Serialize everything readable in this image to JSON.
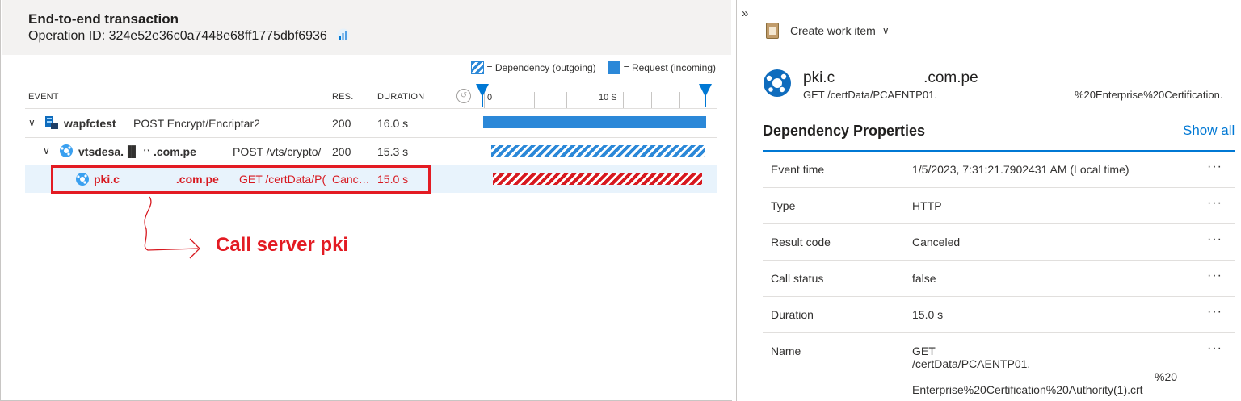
{
  "header": {
    "title": "End-to-end transaction",
    "operation_id": "Operation ID: 324e52e36c0a7448e68ff1775dbf6936"
  },
  "legend": {
    "dependency": "= Dependency (outgoing)",
    "request": "= Request (incoming)"
  },
  "columns": {
    "event": "EVENT",
    "res": "RES.",
    "duration": "DURATION"
  },
  "axis": {
    "start": "0",
    "mid": "10 S"
  },
  "rows": [
    {
      "name": "wapfctest",
      "operation": "POST Encrypt/Encriptar2",
      "res": "200",
      "duration": "16.0 s",
      "start_s": 0.0,
      "dur_s": 16.0
    },
    {
      "name": "vtsdesa.▐▌   ˑˑ .com.pe",
      "operation": "POST /vts/crypto/",
      "res": "200",
      "duration": "15.3 s",
      "start_s": 0.6,
      "dur_s": 15.3
    },
    {
      "name": "pki.c",
      "name_suffix": ".com.pe",
      "operation": "GET /certData/P(",
      "res": "Canc…",
      "duration": "15.0 s",
      "start_s": 0.7,
      "dur_s": 15.0
    }
  ],
  "timeline_max_s": 16.0,
  "annotation": "Call server pki",
  "panel": {
    "create_work_item": "Create work item",
    "dep_name": "pki.c",
    "dep_name_suffix": ".com.pe",
    "dep_url": "GET /certData/PCAENTP01.",
    "dep_url_suffix": "%20Enterprise%20Certification.",
    "props_title": "Dependency Properties",
    "show_all": "Show all",
    "more": "···",
    "properties": [
      {
        "key": "Event time",
        "value": "1/5/2023, 7:31:21.7902431 AM (Local time)"
      },
      {
        "key": "Type",
        "value": "HTTP"
      },
      {
        "key": "Result code",
        "value": "Canceled"
      },
      {
        "key": "Call status",
        "value": "false"
      },
      {
        "key": "Duration",
        "value": "15.0 s"
      },
      {
        "key": "Name",
        "value_lines": [
          "GET",
          "/certData/PCAENTP01.",
          "%20",
          "Enterprise%20Certification%20Authority(1).crt"
        ]
      }
    ]
  }
}
